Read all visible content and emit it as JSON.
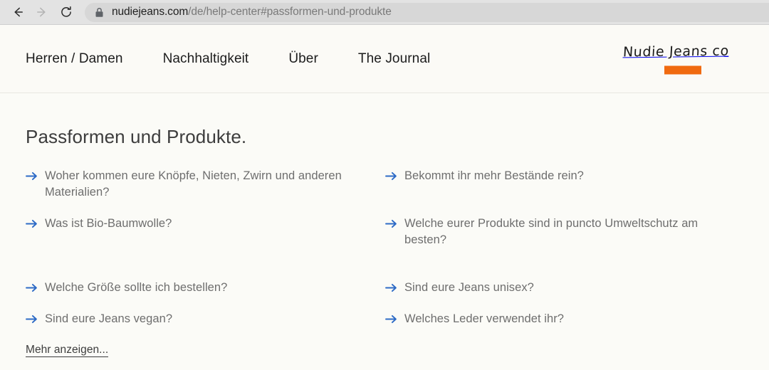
{
  "browser": {
    "back_icon": "arrow-left-icon",
    "forward_icon": "arrow-right-icon",
    "reload_icon": "reload-icon",
    "lock_icon": "lock-icon",
    "url_domain": "nudiejeans.com",
    "url_path": "/de/help-center#passformen-und-produkte",
    "url_full": "nudiejeans.com/de/help-center#passformen-und-produkte"
  },
  "header": {
    "nav": [
      {
        "label": "Herren / Damen"
      },
      {
        "label": "Nachhaltigkeit"
      },
      {
        "label": "Über"
      },
      {
        "label": "The Journal"
      }
    ],
    "logo": {
      "text": "Nudie Jeans co",
      "bar_color": "#f06a10"
    }
  },
  "main": {
    "title": "Passformen und Produkte.",
    "arrow_icon": "arrow-right-icon",
    "arrow_color": "#2e6bc6",
    "faq_rows": [
      {
        "left": "Woher kommen eure Knöpfe, Nieten, Zwirn und anderen Materialien?",
        "right": "Bekommt ihr mehr Bestände rein?"
      },
      {
        "left": "Was ist Bio-Baumwolle?",
        "right": "Welche eurer Produkte sind in puncto Umweltschutz am besten?"
      },
      {
        "left": "Welche Größe sollte ich bestellen?",
        "right": "Sind eure Jeans unisex?"
      },
      {
        "left": "Sind eure Jeans vegan?",
        "right": "Welches Leder verwendet ihr?"
      }
    ],
    "show_more": "Mehr anzeigen..."
  }
}
